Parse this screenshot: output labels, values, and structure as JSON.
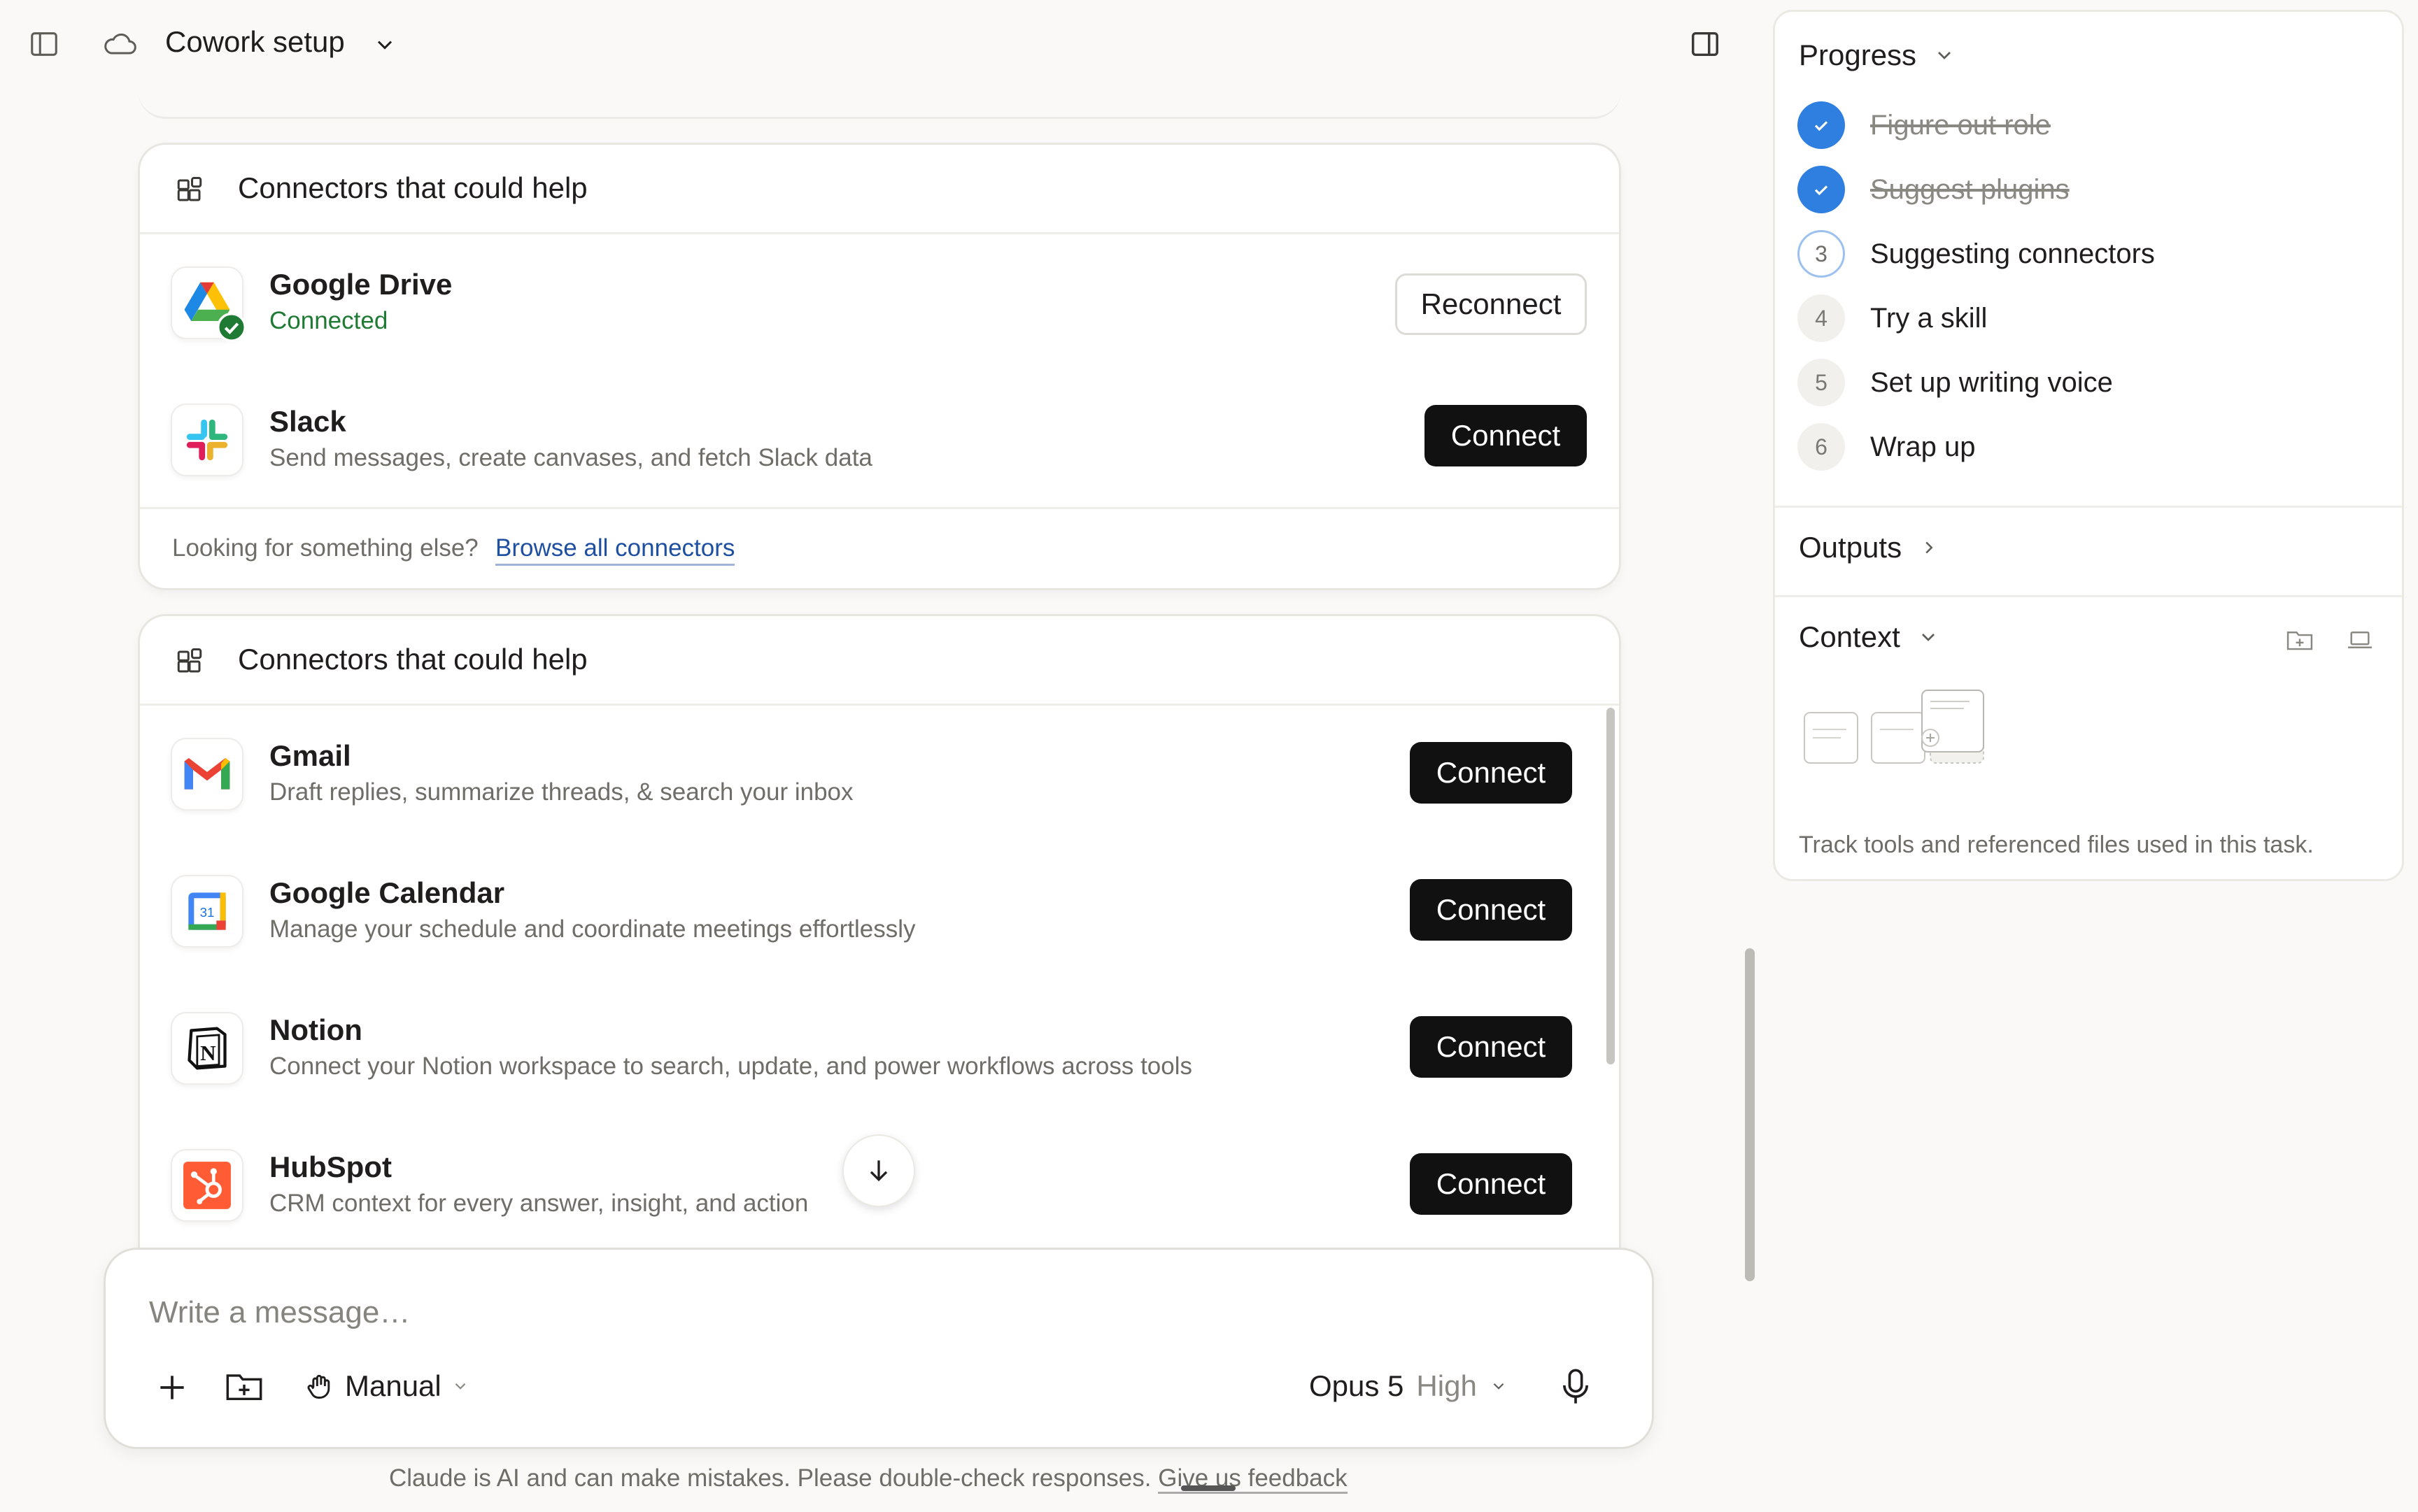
{
  "header": {
    "title": "Cowork setup"
  },
  "cards": [
    {
      "title": "Connectors that could help",
      "items": [
        {
          "name": "Google Drive",
          "description": "Connected",
          "action": "Reconnect"
        },
        {
          "name": "Slack",
          "description": "Send messages, create canvases, and fetch Slack data",
          "action": "Connect"
        }
      ],
      "footer_question": "Looking for something else?",
      "footer_link": "Browse all connectors"
    },
    {
      "title": "Connectors that could help",
      "items": [
        {
          "name": "Gmail",
          "description": "Draft replies, summarize threads, & search your inbox",
          "action": "Connect"
        },
        {
          "name": "Google Calendar",
          "description": "Manage your schedule and coordinate meetings effortlessly",
          "action": "Connect"
        },
        {
          "name": "Notion",
          "description": "Connect your Notion workspace to search, update, and power workflows across tools",
          "action": "Connect"
        },
        {
          "name": "HubSpot",
          "description": "CRM context for every answer, insight, and action",
          "action": "Connect"
        }
      ]
    }
  ],
  "composer": {
    "placeholder": "Write a message…",
    "mode": "Manual",
    "model": "Opus 5",
    "effort": "High"
  },
  "disclaimer": {
    "text": "Claude is AI and can make mistakes. Please double-check responses.",
    "feedback_link": "Give us feedback"
  },
  "panel": {
    "progress_title": "Progress",
    "steps": [
      {
        "label": "Figure out role",
        "status": "done"
      },
      {
        "label": "Suggest plugins",
        "status": "done"
      },
      {
        "number": "3",
        "label": "Suggesting connectors",
        "status": "active"
      },
      {
        "number": "4",
        "label": "Try a skill",
        "status": "pending"
      },
      {
        "number": "5",
        "label": "Set up writing voice",
        "status": "pending"
      },
      {
        "number": "6",
        "label": "Wrap up",
        "status": "pending"
      }
    ],
    "outputs_title": "Outputs",
    "context_title": "Context",
    "context_caption": "Track tools and referenced files used in this task."
  },
  "colors": {
    "accent_blue": "#2f7fe0",
    "connected_green": "#1f7a34",
    "button_dark": "#111111",
    "link_blue": "#1f4fa0"
  },
  "icons": [
    "sidebar-toggle-icon",
    "cloud-icon",
    "chevron-down-icon",
    "panel-toggle-icon",
    "connectors-icon",
    "check-icon",
    "arrow-down-icon",
    "plus-icon",
    "folder-add-icon",
    "hand-icon",
    "microphone-icon",
    "chevron-right-icon",
    "laptop-icon"
  ]
}
